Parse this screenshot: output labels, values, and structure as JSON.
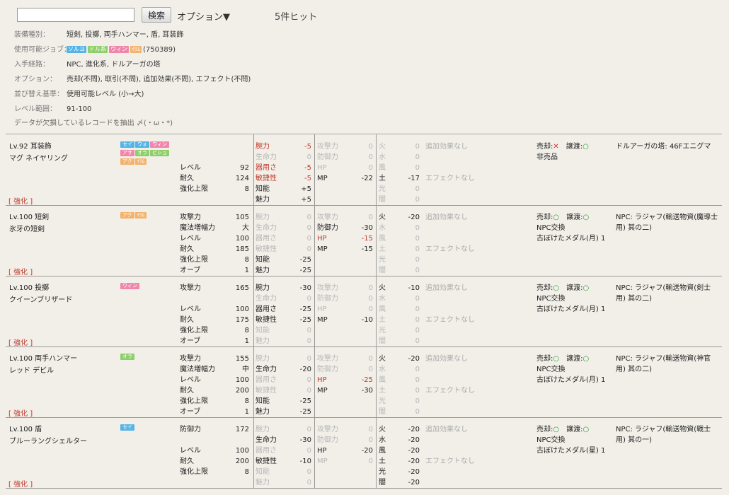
{
  "search": {
    "placeholder": "",
    "value": "",
    "button_label": "検索",
    "options_label": "オプション▼",
    "hit_count": "5件ヒット"
  },
  "filters": {
    "equip_type": {
      "label": "装備種別：",
      "value": "短剣, 投擲, 両手ハンマー, 盾, 耳装飾"
    },
    "jobs": {
      "label": "使用可能ジョブ：",
      "tags": [
        {
          "text": "ソルヨ",
          "color": "#55b4e6"
        },
        {
          "text": "ドル系",
          "color": "#8fcf6b"
        },
        {
          "text": "ウィン",
          "color": "#ef87ad"
        },
        {
          "text": "ｲﾘﾑ",
          "color": "#f3b36d"
        }
      ],
      "code": "(750389)"
    },
    "source": {
      "label": "入手経路：",
      "value": "NPC, 進化系, ドルアーガの塔"
    },
    "options": {
      "label": "オプション：",
      "value": "売却(不問), 取引(不問), 追加効果(不問), エフェクト(不問)"
    },
    "sort": {
      "label": "並び替え基準：",
      "value": "使用可能レベル (小→大)"
    },
    "level": {
      "label": "レベル範囲：",
      "value": "91-100"
    },
    "extract": "データが欠損しているレコードを抽出 〆(・ω・*)"
  },
  "colors": {
    "accent_red": "#c0392b",
    "ok_green": "#2a9a3a",
    "ng_red": "#d33333"
  },
  "items": [
    {
      "title": "Lv.92 耳装飾",
      "name": "マグ ネイヤリング",
      "enhance": "[ 強化 ]",
      "tags": [
        {
          "text": "セイ",
          "color": "#55b4e6"
        },
        {
          "text": "ウォ",
          "color": "#55b4e6"
        },
        {
          "text": "ウィン",
          "color": "#ef87ad"
        },
        {
          "text": "アサ",
          "color": "#ef87ad"
        },
        {
          "text": "オラ",
          "color": "#8fcf6b"
        },
        {
          "text": "ビショ",
          "color": "#8fcf6b"
        },
        {
          "text": "アク",
          "color": "#f3b36d"
        },
        {
          "text": "ｲﾘﾑ",
          "color": "#f3b36d"
        }
      ],
      "base": [
        {
          "k": "",
          "v": ""
        },
        {
          "k": "",
          "v": ""
        },
        {
          "k": "レベル",
          "v": "92"
        },
        {
          "k": "耐久",
          "v": "124"
        },
        {
          "k": "強化上限",
          "v": "8"
        }
      ],
      "ability": [
        {
          "k": "腕力",
          "v": "-5",
          "c": "neg"
        },
        {
          "k": "生命力",
          "v": "0",
          "c": "dim"
        },
        {
          "k": "器用さ",
          "v": "-5",
          "c": "neg"
        },
        {
          "k": "敏捷性",
          "v": "-5",
          "c": "neg"
        },
        {
          "k": "知能",
          "v": "+5",
          "c": ""
        },
        {
          "k": "魅力",
          "v": "+5",
          "c": ""
        }
      ],
      "resist": [
        {
          "k": "攻撃力",
          "v": "0",
          "c": "dim"
        },
        {
          "k": "防御力",
          "v": "0",
          "c": "dim"
        },
        {
          "k": "HP",
          "v": "0",
          "c": "dim"
        },
        {
          "k": "MP",
          "v": "-22",
          "c": ""
        }
      ],
      "element": [
        {
          "k": "火",
          "v": "0",
          "c": "dim"
        },
        {
          "k": "水",
          "v": "0",
          "c": "dim"
        },
        {
          "k": "風",
          "v": "0",
          "c": "dim"
        },
        {
          "k": "土",
          "v": "-17",
          "c": ""
        },
        {
          "k": "光",
          "v": "0",
          "c": "dim"
        },
        {
          "k": "闇",
          "v": "0",
          "c": "dim"
        }
      ],
      "effect": [
        "追加効果なし",
        "",
        "",
        "エフェクトなし"
      ],
      "trade": {
        "sell_label": "売却:",
        "sell_mark": "✕",
        "sell_ok": false,
        "give_label": "譲渡:",
        "give_mark": "○",
        "give_ok": true,
        "lines": [
          "非売品"
        ]
      },
      "source": "ドルアーガの塔: 46Fエニグマ"
    },
    {
      "title": "Lv.100 短剣",
      "name": "氷牙の短剣",
      "enhance": "[ 強化 ]",
      "tags": [
        {
          "text": "アク",
          "color": "#f3b36d"
        },
        {
          "text": "ｲﾘﾑ",
          "color": "#f3b36d"
        }
      ],
      "base": [
        {
          "k": "攻撃力",
          "v": "105"
        },
        {
          "k": "魔法増幅力",
          "v": "大"
        },
        {
          "k": "レベル",
          "v": "100"
        },
        {
          "k": "耐久",
          "v": "185"
        },
        {
          "k": "強化上限",
          "v": "8"
        },
        {
          "k": "オーブ",
          "v": "1"
        }
      ],
      "ability": [
        {
          "k": "腕力",
          "v": "0",
          "c": "dim"
        },
        {
          "k": "生命力",
          "v": "0",
          "c": "dim"
        },
        {
          "k": "器用さ",
          "v": "0",
          "c": "dim"
        },
        {
          "k": "敏捷性",
          "v": "0",
          "c": "dim"
        },
        {
          "k": "知能",
          "v": "-25",
          "c": ""
        },
        {
          "k": "魅力",
          "v": "-25",
          "c": ""
        }
      ],
      "resist": [
        {
          "k": "攻撃力",
          "v": "0",
          "c": "dim"
        },
        {
          "k": "防御力",
          "v": "-30",
          "c": ""
        },
        {
          "k": "HP",
          "v": "-15",
          "c": "neg"
        },
        {
          "k": "MP",
          "v": "-15",
          "c": ""
        }
      ],
      "element": [
        {
          "k": "火",
          "v": "-20",
          "c": ""
        },
        {
          "k": "水",
          "v": "0",
          "c": "dim"
        },
        {
          "k": "風",
          "v": "0",
          "c": "dim"
        },
        {
          "k": "土",
          "v": "0",
          "c": "dim"
        },
        {
          "k": "光",
          "v": "0",
          "c": "dim"
        },
        {
          "k": "闇",
          "v": "0",
          "c": "dim"
        }
      ],
      "effect": [
        "追加効果なし",
        "",
        "",
        "エフェクトなし"
      ],
      "trade": {
        "sell_label": "売却:",
        "sell_mark": "○",
        "sell_ok": true,
        "give_label": "譲渡:",
        "give_mark": "○",
        "give_ok": true,
        "lines": [
          "NPC交換",
          "古ぼけたメダル(月) 1"
        ]
      },
      "source": "NPC: ラジャフ(輸送物資(魔導士用) 其の二)"
    },
    {
      "title": "Lv.100 投擲",
      "name": "クイーンブリザード",
      "enhance": "[ 強化 ]",
      "tags": [
        {
          "text": "ウィン",
          "color": "#ef87ad"
        }
      ],
      "base": [
        {
          "k": "攻撃力",
          "v": "165"
        },
        {
          "k": "",
          "v": ""
        },
        {
          "k": "レベル",
          "v": "100"
        },
        {
          "k": "耐久",
          "v": "175"
        },
        {
          "k": "強化上限",
          "v": "8"
        },
        {
          "k": "オーブ",
          "v": "1"
        }
      ],
      "ability": [
        {
          "k": "腕力",
          "v": "-30",
          "c": ""
        },
        {
          "k": "生命力",
          "v": "0",
          "c": "dim"
        },
        {
          "k": "器用さ",
          "v": "-25",
          "c": ""
        },
        {
          "k": "敏捷性",
          "v": "-25",
          "c": ""
        },
        {
          "k": "知能",
          "v": "0",
          "c": "dim"
        },
        {
          "k": "魅力",
          "v": "0",
          "c": "dim"
        }
      ],
      "resist": [
        {
          "k": "攻撃力",
          "v": "0",
          "c": "dim"
        },
        {
          "k": "防御力",
          "v": "0",
          "c": "dim"
        },
        {
          "k": "HP",
          "v": "0",
          "c": "dim"
        },
        {
          "k": "MP",
          "v": "-10",
          "c": ""
        }
      ],
      "element": [
        {
          "k": "火",
          "v": "-10",
          "c": ""
        },
        {
          "k": "水",
          "v": "0",
          "c": "dim"
        },
        {
          "k": "風",
          "v": "0",
          "c": "dim"
        },
        {
          "k": "土",
          "v": "0",
          "c": "dim"
        },
        {
          "k": "光",
          "v": "0",
          "c": "dim"
        },
        {
          "k": "闇",
          "v": "0",
          "c": "dim"
        }
      ],
      "effect": [
        "追加効果なし",
        "",
        "",
        "エフェクトなし"
      ],
      "trade": {
        "sell_label": "売却:",
        "sell_mark": "○",
        "sell_ok": true,
        "give_label": "譲渡:",
        "give_mark": "○",
        "give_ok": true,
        "lines": [
          "NPC交換",
          "古ぼけたメダル(月) 1"
        ]
      },
      "source": "NPC: ラジャフ(輸送物資(剣士用) 其の二)"
    },
    {
      "title": "Lv.100 両手ハンマー",
      "name": "レッド デビル",
      "enhance": "[ 強化 ]",
      "tags": [
        {
          "text": "オラ",
          "color": "#8fcf6b"
        }
      ],
      "base": [
        {
          "k": "攻撃力",
          "v": "155"
        },
        {
          "k": "魔法増幅力",
          "v": "中"
        },
        {
          "k": "レベル",
          "v": "100"
        },
        {
          "k": "耐久",
          "v": "200"
        },
        {
          "k": "強化上限",
          "v": "8"
        },
        {
          "k": "オーブ",
          "v": "1"
        }
      ],
      "ability": [
        {
          "k": "腕力",
          "v": "0",
          "c": "dim"
        },
        {
          "k": "生命力",
          "v": "-20",
          "c": ""
        },
        {
          "k": "器用さ",
          "v": "0",
          "c": "dim"
        },
        {
          "k": "敏捷性",
          "v": "0",
          "c": "dim"
        },
        {
          "k": "知能",
          "v": "-25",
          "c": ""
        },
        {
          "k": "魅力",
          "v": "-25",
          "c": ""
        }
      ],
      "resist": [
        {
          "k": "攻撃力",
          "v": "0",
          "c": "dim"
        },
        {
          "k": "防御力",
          "v": "0",
          "c": "dim"
        },
        {
          "k": "HP",
          "v": "-25",
          "c": "neg"
        },
        {
          "k": "MP",
          "v": "-30",
          "c": ""
        }
      ],
      "element": [
        {
          "k": "火",
          "v": "-20",
          "c": ""
        },
        {
          "k": "水",
          "v": "0",
          "c": "dim"
        },
        {
          "k": "風",
          "v": "0",
          "c": "dim"
        },
        {
          "k": "土",
          "v": "0",
          "c": "dim"
        },
        {
          "k": "光",
          "v": "0",
          "c": "dim"
        },
        {
          "k": "闇",
          "v": "0",
          "c": "dim"
        }
      ],
      "effect": [
        "追加効果なし",
        "",
        "",
        "エフェクトなし"
      ],
      "trade": {
        "sell_label": "売却:",
        "sell_mark": "○",
        "sell_ok": true,
        "give_label": "譲渡:",
        "give_mark": "○",
        "give_ok": true,
        "lines": [
          "NPC交換",
          "古ぼけたメダル(月) 1"
        ]
      },
      "source": "NPC: ラジャフ(輸送物資(神官用) 其の二)"
    },
    {
      "title": "Lv.100 盾",
      "name": "ブルーラングシェルター",
      "enhance": "[ 強化 ]",
      "tags": [
        {
          "text": "セイ",
          "color": "#55b4e6"
        }
      ],
      "base": [
        {
          "k": "防御力",
          "v": "172"
        },
        {
          "k": "",
          "v": ""
        },
        {
          "k": "レベル",
          "v": "100"
        },
        {
          "k": "耐久",
          "v": "200"
        },
        {
          "k": "強化上限",
          "v": "8"
        }
      ],
      "ability": [
        {
          "k": "腕力",
          "v": "0",
          "c": "dim"
        },
        {
          "k": "生命力",
          "v": "-30",
          "c": ""
        },
        {
          "k": "器用さ",
          "v": "0",
          "c": "dim"
        },
        {
          "k": "敏捷性",
          "v": "-10",
          "c": ""
        },
        {
          "k": "知能",
          "v": "0",
          "c": "dim"
        },
        {
          "k": "魅力",
          "v": "0",
          "c": "dim"
        }
      ],
      "resist": [
        {
          "k": "攻撃力",
          "v": "0",
          "c": "dim"
        },
        {
          "k": "防御力",
          "v": "0",
          "c": "dim"
        },
        {
          "k": "HP",
          "v": "-20",
          "c": ""
        },
        {
          "k": "MP",
          "v": "0",
          "c": "dim"
        }
      ],
      "element": [
        {
          "k": "火",
          "v": "-20",
          "c": ""
        },
        {
          "k": "水",
          "v": "-20",
          "c": ""
        },
        {
          "k": "風",
          "v": "-20",
          "c": ""
        },
        {
          "k": "土",
          "v": "-20",
          "c": ""
        },
        {
          "k": "光",
          "v": "-20",
          "c": ""
        },
        {
          "k": "闇",
          "v": "-20",
          "c": ""
        }
      ],
      "effect": [
        "追加効果なし",
        "",
        "",
        "エフェクトなし"
      ],
      "trade": {
        "sell_label": "売却:",
        "sell_mark": "○",
        "sell_ok": true,
        "give_label": "譲渡:",
        "give_mark": "○",
        "give_ok": true,
        "lines": [
          "NPC交換",
          "古ぼけたメダル(星) 1"
        ]
      },
      "source": "NPC: ラジャフ(輸送物資(戦士用) 其の一)"
    }
  ]
}
